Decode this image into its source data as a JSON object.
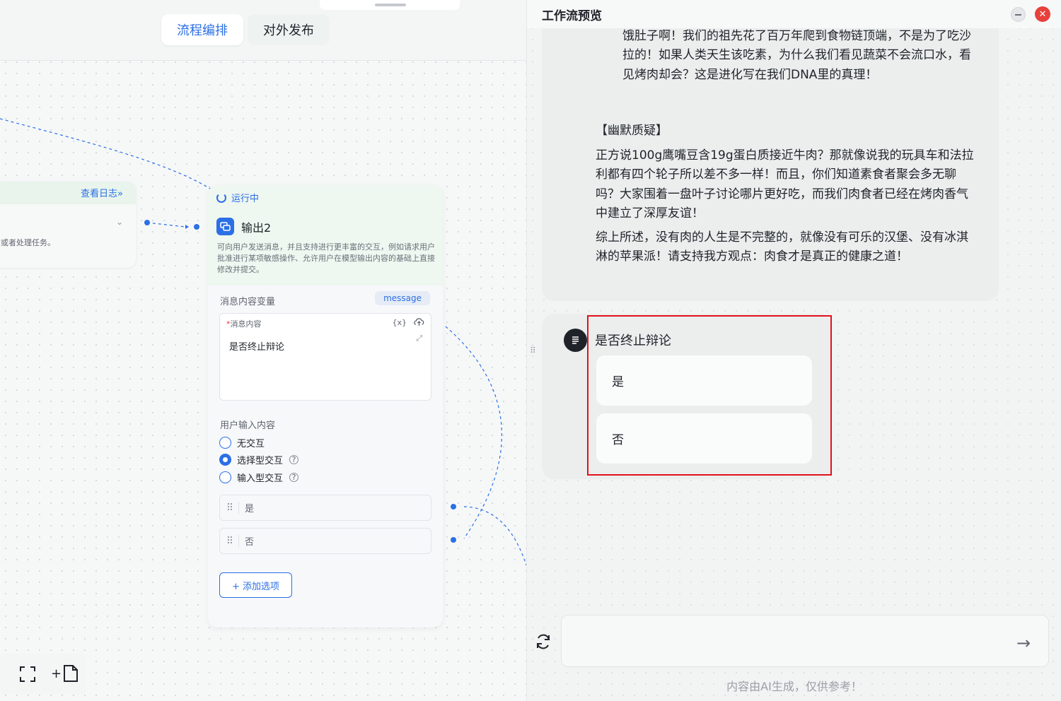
{
  "canvas": {
    "tabs": [
      {
        "label": "流程编排"
      },
      {
        "label": "对外发布"
      }
    ],
    "prev_node": {
      "view_log": "查看日志»",
      "desc": "意或者处理任务。"
    },
    "output_node": {
      "status": "运行中",
      "title": "输出2",
      "desc": "可向用户发送消息，并且支持进行更丰富的交互，例如请求用户批准进行某项敏感操作、允许用户在模型输出内容的基础上直接修改并提交。",
      "msg_var_label": "消息内容变量",
      "msg_var_tag": "message",
      "msg_box_label": "消息内容",
      "msg_box_required": "*",
      "var_icon_text": "{x}",
      "msg_content": "是否终止辩论",
      "user_input_label": "用户输入内容",
      "radios": [
        {
          "label": "无交互",
          "checked": false
        },
        {
          "label": "选择型交互",
          "checked": true
        },
        {
          "label": "输入型交互",
          "checked": false
        }
      ],
      "options": [
        {
          "label": "是"
        },
        {
          "label": "否"
        }
      ],
      "add_option": "+ 添加选项"
    }
  },
  "preview": {
    "title": "工作流预览",
    "close_glyph": "✕",
    "message": {
      "para1": "饿肚子啊！我们的祖先花了百万年爬到食物链顶端，不是为了吃沙拉的！如果人类天生该吃素，为什么我们看见蔬菜不会流口水，看见烤肉却会？这是进化写在我们DNA里的真理！",
      "section_title": "【幽默质疑】",
      "para2": "正方说100g鹰嘴豆含19g蛋白质接近牛肉？那就像说我的玩具车和法拉利都有四个轮子所以差不多一样！而且，你们知道素食者聚会多无聊吗？大家围着一盘叶子讨论哪片更好吃，而我们肉食者已经在烤肉香气中建立了深厚友谊！",
      "para3": "综上所述，没有肉的人生是不完整的，就像没有可乐的汉堡、没有冰淇淋的苹果派！请支持我方观点：肉食才是真正的健康之道！"
    },
    "choice": {
      "question": "是否终止辩论",
      "options": [
        {
          "label": "是"
        },
        {
          "label": "否"
        }
      ]
    },
    "input_placeholder": "",
    "send_glyph": "→",
    "disclaimer": "内容由AI生成，仅供参考！"
  },
  "colors": {
    "accent": "#2b6fe6",
    "highlight": "#e3111b",
    "close": "#e8403b"
  }
}
